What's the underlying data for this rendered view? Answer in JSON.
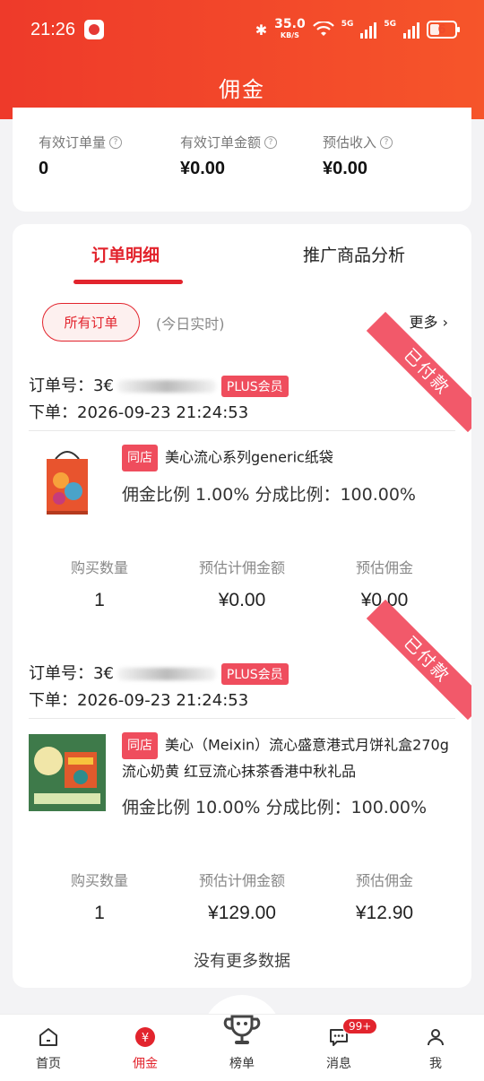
{
  "status": {
    "time": "21:26",
    "speed_value": "35.0",
    "speed_unit": "KB/S",
    "net1": "5G",
    "net2": "5G",
    "battery": "6"
  },
  "header": {
    "title": "佣金"
  },
  "stats": [
    {
      "label": "有效订单量",
      "value": "0"
    },
    {
      "label": "有效订单金额",
      "value": "¥0.00"
    },
    {
      "label": "预估收入",
      "value": "¥0.00"
    }
  ],
  "tabs": [
    {
      "label": "订单明细"
    },
    {
      "label": "推广商品分析"
    }
  ],
  "filter": {
    "pill": "所有订单",
    "realtime": "(今日实时)",
    "more": "更多 ›"
  },
  "orders": [
    {
      "status": "已付款",
      "order_no_label": "订单号：",
      "order_no_visible": "3€",
      "member_tag": "PLUS会员",
      "order_time": "下单：2026-09-23 21:24:53",
      "store_tag": "同店",
      "product_name": "美心流心系列generic纸袋",
      "rate_text": "佣金比例 1.00%    分成比例：100.00%",
      "metrics": [
        {
          "label": "购买数量",
          "value": "1"
        },
        {
          "label": "预估计佣金额",
          "value": "¥0.00"
        },
        {
          "label": "预估佣金",
          "value": "¥0.00"
        }
      ]
    },
    {
      "status": "已付款",
      "order_no_label": "订单号：",
      "order_no_visible": "3€",
      "member_tag": "PLUS会员",
      "order_time": "下单：2026-09-23 21:24:53",
      "store_tag": "同店",
      "product_name": "美心（Meixin）流心盛意港式月饼礼盒270g 流心奶黄 红豆流心抹茶香港中秋礼品",
      "rate_text": "佣金比例 10.00%    分成比例：100.00%",
      "metrics": [
        {
          "label": "购买数量",
          "value": "1"
        },
        {
          "label": "预估计佣金额",
          "value": "¥129.00"
        },
        {
          "label": "预估佣金",
          "value": "¥12.90"
        }
      ]
    }
  ],
  "footer": {
    "no_more": "没有更多数据"
  },
  "nav": [
    {
      "label": "首页",
      "icon": "home-icon"
    },
    {
      "label": "佣金",
      "icon": "commission-icon"
    },
    {
      "label": "榜单",
      "icon": "trophy-icon"
    },
    {
      "label": "消息",
      "icon": "message-icon",
      "badge": "99+"
    },
    {
      "label": "我",
      "icon": "user-icon"
    }
  ],
  "colors": {
    "brand": "#e2242d",
    "header": "#f04a2a",
    "ribbon": "#f2596a"
  }
}
